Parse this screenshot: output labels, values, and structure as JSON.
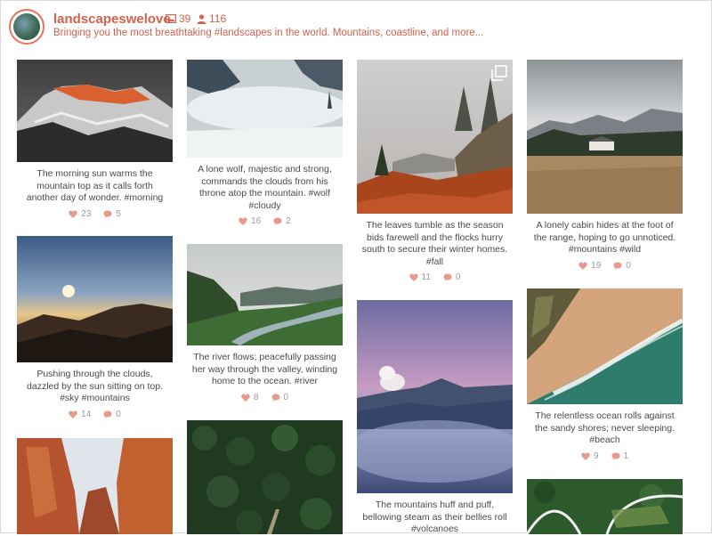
{
  "profile": {
    "username": "landscapeswelove",
    "posts_count": "39",
    "followers_count": "116",
    "tagline": "Bringing you the most breathtaking #landscapes in the world. Mountains, coastline, and more...",
    "accent_color": "#d4614c"
  },
  "posts": [
    {
      "caption": "The morning sun warms the mountain top as it calls forth another day of wonder. #morning",
      "likes": "23",
      "comments": "5"
    },
    {
      "caption": "Pushing through the clouds, dazzled by the sun sitting on top. #sky #mountains",
      "likes": "14",
      "comments": "0"
    },
    {
      "caption": "",
      "likes": "",
      "comments": ""
    },
    {
      "caption": "A lone wolf, majestic and strong, commands the clouds from his throne atop the mountain. #wolf #cloudy",
      "likes": "16",
      "comments": "2"
    },
    {
      "caption": "The river flows; peacefully passing her way through the valley, winding home to the ocean. #river",
      "likes": "8",
      "comments": "0"
    },
    {
      "caption": "",
      "likes": "",
      "comments": ""
    },
    {
      "caption": "The leaves tumble as the season bids farewell and the flocks hurry south to secure their winter homes. #fall",
      "likes": "11",
      "comments": "0"
    },
    {
      "caption": "The mountains huff and puff, bellowing steam as their bellies roll #volcanoes",
      "likes": "",
      "comments": ""
    },
    {
      "caption": "A lonely cabin hides at the foot of the range, hoping to go unnoticed. #mountains #wild",
      "likes": "19",
      "comments": "0"
    },
    {
      "caption": "The relentless ocean rolls against the sandy shores; never sleeping. #beach",
      "likes": "9",
      "comments": "1"
    },
    {
      "caption": "",
      "likes": "",
      "comments": ""
    }
  ],
  "icons": {
    "posts": "image-icon",
    "followers": "person-icon",
    "likes": "heart-icon",
    "comments": "comment-bubble-icon",
    "multi_photo": "multiple-photos-icon"
  }
}
